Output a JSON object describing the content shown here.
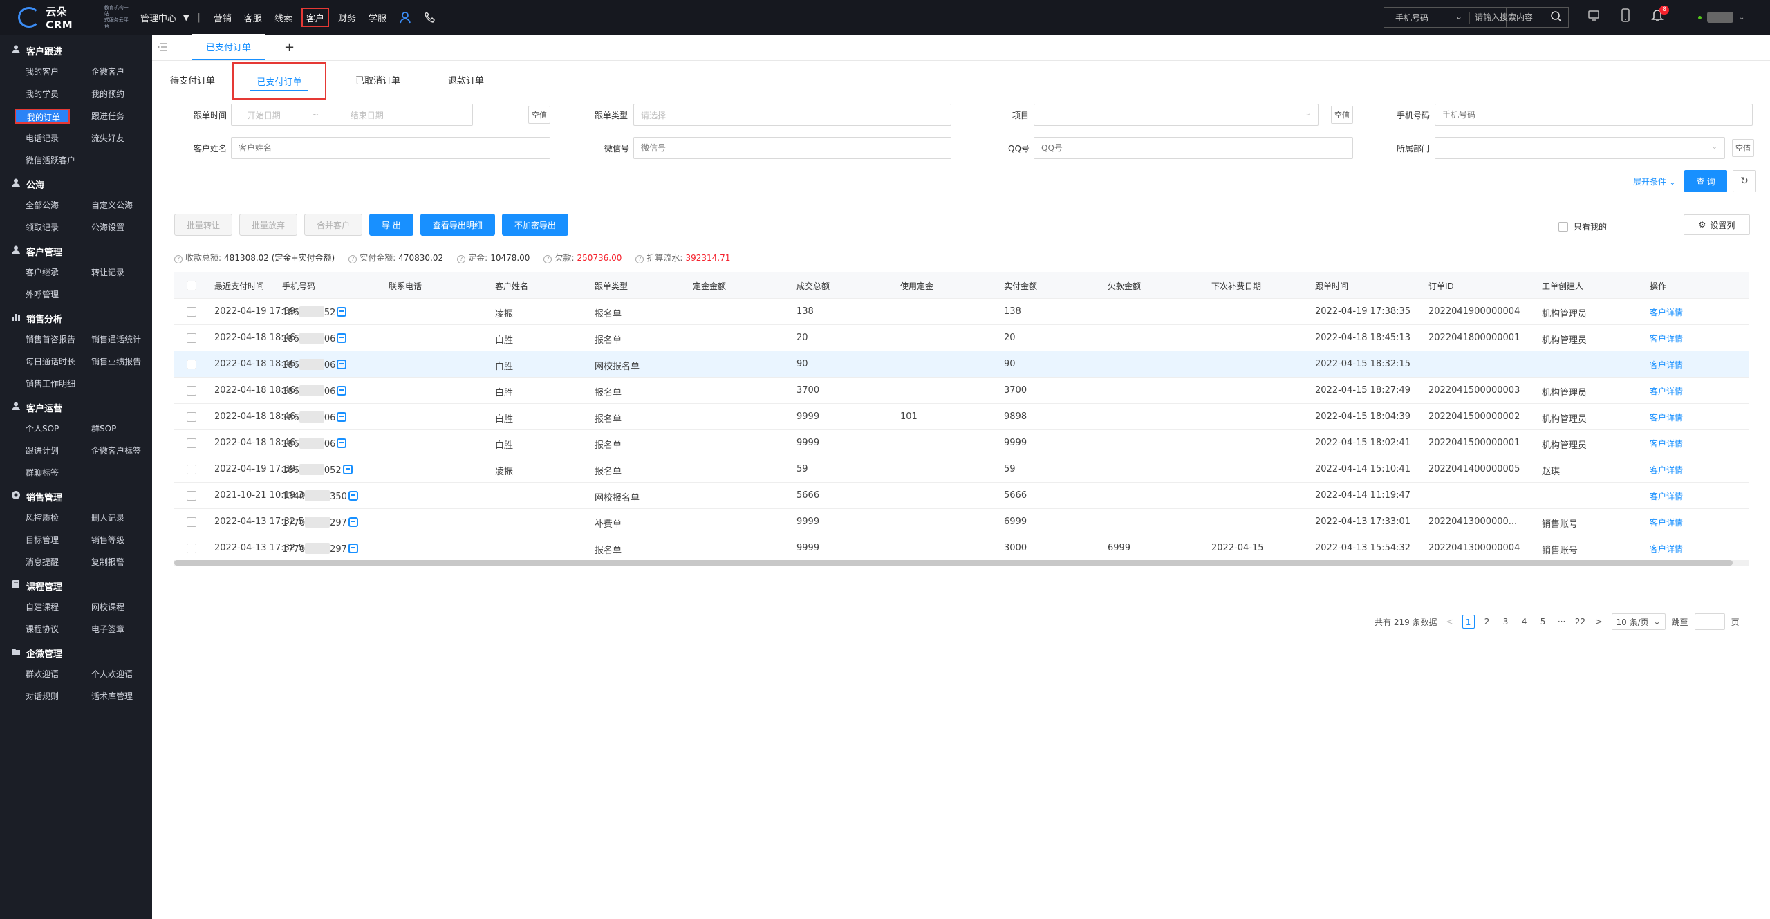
{
  "app": {
    "logo_text": "云朵CRM",
    "logo_sub_line1": "教育机构一站",
    "logo_sub_line2": "式服务云平台",
    "logo_url": "www.yunduocrm.com"
  },
  "topnav": {
    "mgmt": "管理中心",
    "items": [
      "营销",
      "客服",
      "线索",
      "客户",
      "财务",
      "学服"
    ],
    "active_index": 3,
    "search_select": "手机号码",
    "search_placeholder": "请输入搜索内容",
    "notif_count": "8"
  },
  "sidebar": {
    "groups": [
      {
        "title": "客户跟进",
        "icon": "person-icon",
        "items": [
          "我的客户",
          "企微客户",
          "我的学员",
          "我的预约",
          "我的订单",
          "跟进任务",
          "电话记录",
          "流失好友",
          "微信活跃客户"
        ]
      },
      {
        "title": "公海",
        "icon": "person-icon",
        "items": [
          "全部公海",
          "自定义公海",
          "领取记录",
          "公海设置"
        ]
      },
      {
        "title": "客户管理",
        "icon": "person-icon",
        "items": [
          "客户继承",
          "转让记录",
          "外呼管理"
        ]
      },
      {
        "title": "销售分析",
        "icon": "chart-icon",
        "items": [
          "销售首咨报告",
          "销售通话统计",
          "每日通话时长",
          "销售业绩报告",
          "销售工作明细"
        ]
      },
      {
        "title": "客户运营",
        "icon": "person-icon",
        "items": [
          "个人SOP",
          "群SOP",
          "跟进计划",
          "企微客户标签",
          "群聊标签"
        ]
      },
      {
        "title": "销售管理",
        "icon": "target-icon",
        "items": [
          "风控质检",
          "删人记录",
          "目标管理",
          "销售等级",
          "消息提醒",
          "复制报警"
        ]
      },
      {
        "title": "课程管理",
        "icon": "book-icon",
        "items": [
          "自建课程",
          "网校课程",
          "课程协议",
          "电子签章"
        ]
      },
      {
        "title": "企微管理",
        "icon": "folder-icon",
        "items": [
          "群欢迎语",
          "个人欢迎语",
          "对话规则",
          "话术库管理"
        ]
      }
    ],
    "active_item": "我的订单"
  },
  "tabs": {
    "open_tab": "已支付订单",
    "add": "+"
  },
  "subtabs": [
    "待支付订单",
    "已支付订单",
    "已取消订单",
    "退款订单"
  ],
  "filters": {
    "order_time_label": "跟单时间",
    "start_placeholder": "开始日期",
    "range_sep": "~",
    "end_placeholder": "结束日期",
    "empty_btn": "空值",
    "order_type_label": "跟单类型",
    "order_type_placeholder": "请选择",
    "project_label": "项目",
    "phone_label": "手机号码",
    "phone_placeholder": "手机号码",
    "name_label": "客户姓名",
    "name_placeholder": "客户姓名",
    "wechat_label": "微信号",
    "wechat_placeholder": "微信号",
    "qq_label": "QQ号",
    "qq_placeholder": "QQ号",
    "dept_label": "所属部门",
    "expand": "展开条件",
    "query": "查 询"
  },
  "actions": {
    "batch_transfer": "批量转让",
    "batch_abandon": "批量放弃",
    "merge": "合并客户",
    "export": "导 出",
    "view_export": "查看导出明细",
    "export_plain": "不加密导出",
    "only_mine": "只看我的",
    "set_columns": "设置列"
  },
  "stats": {
    "total_label": "收款总额:",
    "total_value": "481308.02 (定金+实付金额)",
    "paid_label": "实付金额:",
    "paid_value": "470830.02",
    "deposit_label": "定金:",
    "deposit_value": "10478.00",
    "owed_label": "欠款:",
    "owed_value": "250736.00",
    "discount_label": "折算流水:",
    "discount_value": "392314.71"
  },
  "table": {
    "columns": [
      "最近支付时间",
      "手机号码",
      "联系电话",
      "客户姓名",
      "跟单类型",
      "定金金额",
      "成交总额",
      "使用定金",
      "实付金额",
      "欠款金额",
      "下次补费日期",
      "跟单时间",
      "订单ID",
      "工单创建人",
      "操作"
    ],
    "rows": [
      {
        "pay_time": "2022-04-19 17:39:35",
        "phone_a": "186",
        "phone_b": "52",
        "name": "凌振",
        "type": "报名单",
        "deposit": "",
        "total": "138",
        "used": "",
        "paid": "138",
        "owed": "",
        "next": "",
        "order_time": "2022-04-19 17:38:35",
        "order_id": "2022041900000004",
        "creator": "机构管理员",
        "op": "客户详情"
      },
      {
        "pay_time": "2022-04-18 18:46:01",
        "phone_a": "186",
        "phone_b": "06",
        "name": "白胜",
        "type": "报名单",
        "deposit": "",
        "total": "20",
        "used": "",
        "paid": "20",
        "owed": "",
        "next": "",
        "order_time": "2022-04-18 18:45:13",
        "order_id": "2022041800000001",
        "creator": "机构管理员",
        "op": "客户详情"
      },
      {
        "pay_time": "2022-04-18 18:46:01",
        "phone_a": "186",
        "phone_b": "06",
        "name": "白胜",
        "type": "网校报名单",
        "deposit": "",
        "total": "90",
        "used": "",
        "paid": "90",
        "owed": "",
        "next": "",
        "order_time": "2022-04-15 18:32:15",
        "order_id": "",
        "creator": "",
        "op": "客户详情"
      },
      {
        "pay_time": "2022-04-18 18:46:01",
        "phone_a": "186",
        "phone_b": "06",
        "name": "白胜",
        "type": "报名单",
        "deposit": "",
        "total": "3700",
        "used": "",
        "paid": "3700",
        "owed": "",
        "next": "",
        "order_time": "2022-04-15 18:27:49",
        "order_id": "2022041500000003",
        "creator": "机构管理员",
        "op": "客户详情"
      },
      {
        "pay_time": "2022-04-18 18:46:01",
        "phone_a": "186",
        "phone_b": "06",
        "name": "白胜",
        "type": "报名单",
        "deposit": "",
        "total": "9999",
        "used": "101",
        "paid": "9898",
        "owed": "",
        "next": "",
        "order_time": "2022-04-15 18:04:39",
        "order_id": "2022041500000002",
        "creator": "机构管理员",
        "op": "客户详情"
      },
      {
        "pay_time": "2022-04-18 18:46:01",
        "phone_a": "186",
        "phone_b": "06",
        "name": "白胜",
        "type": "报名单",
        "deposit": "",
        "total": "9999",
        "used": "",
        "paid": "9999",
        "owed": "",
        "next": "",
        "order_time": "2022-04-15 18:02:41",
        "order_id": "2022041500000001",
        "creator": "机构管理员",
        "op": "客户详情"
      },
      {
        "pay_time": "2022-04-19 17:39:35",
        "phone_a": "186",
        "phone_b": "052",
        "name": "凌振",
        "type": "报名单",
        "deposit": "",
        "total": "59",
        "used": "",
        "paid": "59",
        "owed": "",
        "next": "",
        "order_time": "2022-04-14 15:10:41",
        "order_id": "2022041400000005",
        "creator": "赵琪",
        "op": "客户详情"
      },
      {
        "pay_time": "2021-10-21 10:19:30",
        "phone_a": "1340",
        "phone_b": "350",
        "name": "",
        "type": "网校报名单",
        "deposit": "",
        "total": "5666",
        "used": "",
        "paid": "5666",
        "owed": "",
        "next": "",
        "order_time": "2022-04-14 11:19:47",
        "order_id": "",
        "creator": "",
        "op": "客户详情"
      },
      {
        "pay_time": "2022-04-13 17:32:55",
        "phone_a": "1770",
        "phone_b": "297",
        "name": "",
        "type": "补费单",
        "deposit": "",
        "total": "9999",
        "used": "",
        "paid": "6999",
        "owed": "",
        "next": "",
        "order_time": "2022-04-13 17:33:01",
        "order_id": "20220413000000...",
        "creator": "销售账号",
        "op": "客户详情"
      },
      {
        "pay_time": "2022-04-13 17:32:55",
        "phone_a": "1770",
        "phone_b": "297",
        "name": "",
        "type": "报名单",
        "deposit": "",
        "total": "9999",
        "used": "",
        "paid": "3000",
        "owed": "6999",
        "next": "2022-04-15",
        "order_time": "2022-04-13 15:54:32",
        "order_id": "2022041300000004",
        "creator": "销售账号",
        "op": "客户详情"
      }
    ],
    "highlight_row": 2
  },
  "pager": {
    "total": "共有 219 条数据",
    "prev": "<",
    "pages": [
      "1",
      "2",
      "3",
      "4",
      "5",
      "···",
      "22"
    ],
    "active": "1",
    "next": ">",
    "size": "10 条/页",
    "jump": "跳至",
    "page_unit": "页"
  },
  "colors": {
    "accent": "#1890ff",
    "topbar": "#16181f",
    "sidebar": "#1b1e26",
    "red_highlight": "#e53935",
    "owed_red": "#f5222d"
  }
}
